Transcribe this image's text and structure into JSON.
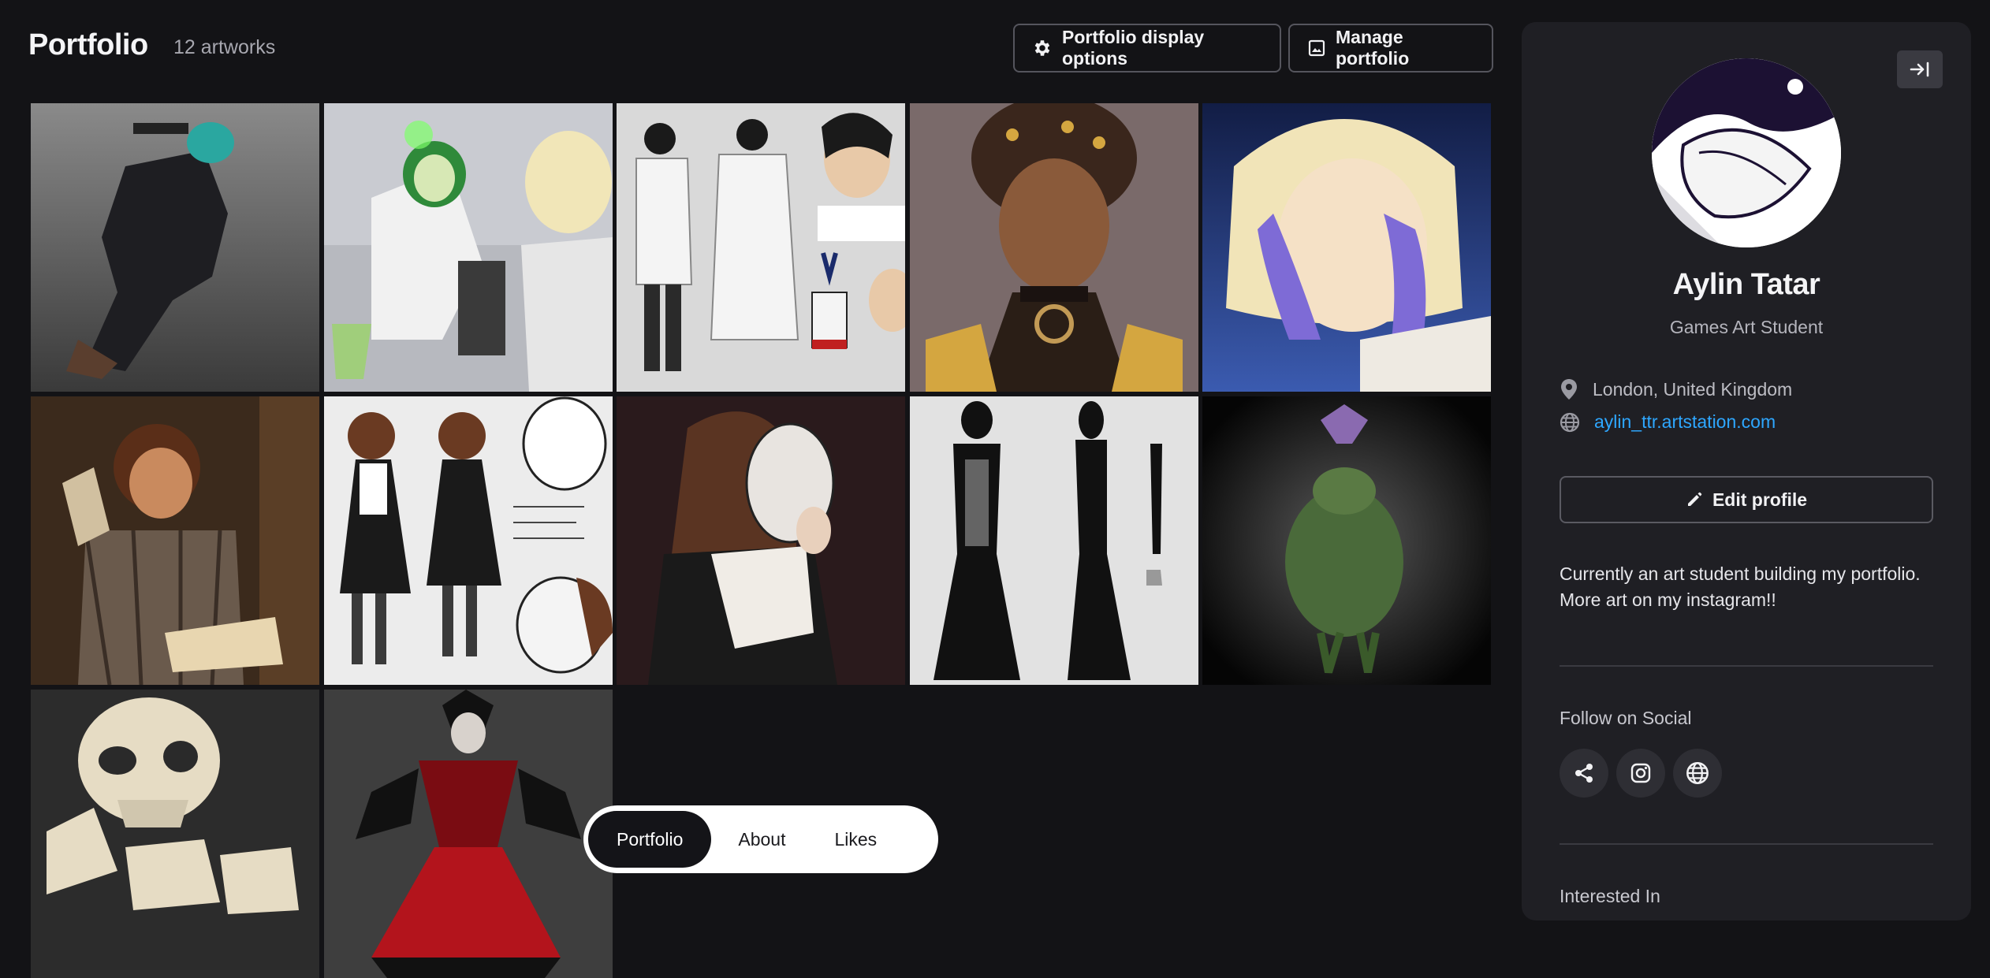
{
  "header": {
    "title": "Portfolio",
    "count": "12 artworks",
    "display_options_label": "Portfolio display options",
    "manage_label": "Manage portfolio"
  },
  "artworks": [
    {
      "subject": "gunman-crouching"
    },
    {
      "subject": "lab-scientist-microscope"
    },
    {
      "subject": "scientist-character-sheet"
    },
    {
      "subject": "gold-jewelry-portrait"
    },
    {
      "subject": "blonde-face-hands"
    },
    {
      "subject": "reader-with-lamp"
    },
    {
      "subject": "girl-mask-turnaround"
    },
    {
      "subject": "woman-holding-mask"
    },
    {
      "subject": "skeleton-dress-ink"
    },
    {
      "subject": "green-creature-3d"
    },
    {
      "subject": "skeleton-closeup"
    },
    {
      "subject": "red-dress-villain-3d"
    }
  ],
  "tabs": [
    {
      "label": "Portfolio",
      "active": true
    },
    {
      "label": "About",
      "active": false
    },
    {
      "label": "Likes",
      "active": false
    }
  ],
  "profile": {
    "name": "Aylin Tatar",
    "role": "Games Art Student",
    "location": "London, United Kingdom",
    "website": "aylin_ttr.artstation.com",
    "edit_label": "Edit profile",
    "bio": "Currently an art student building my portfolio. More art on my instagram!!",
    "follow_heading": "Follow on Social",
    "social": [
      "share-icon",
      "instagram-icon",
      "globe-icon"
    ],
    "interested_heading": "Interested In"
  },
  "colors": {
    "background": "#131316",
    "panel": "#1f1f24",
    "link": "#2ea7ff",
    "active_tab": "#141418"
  }
}
